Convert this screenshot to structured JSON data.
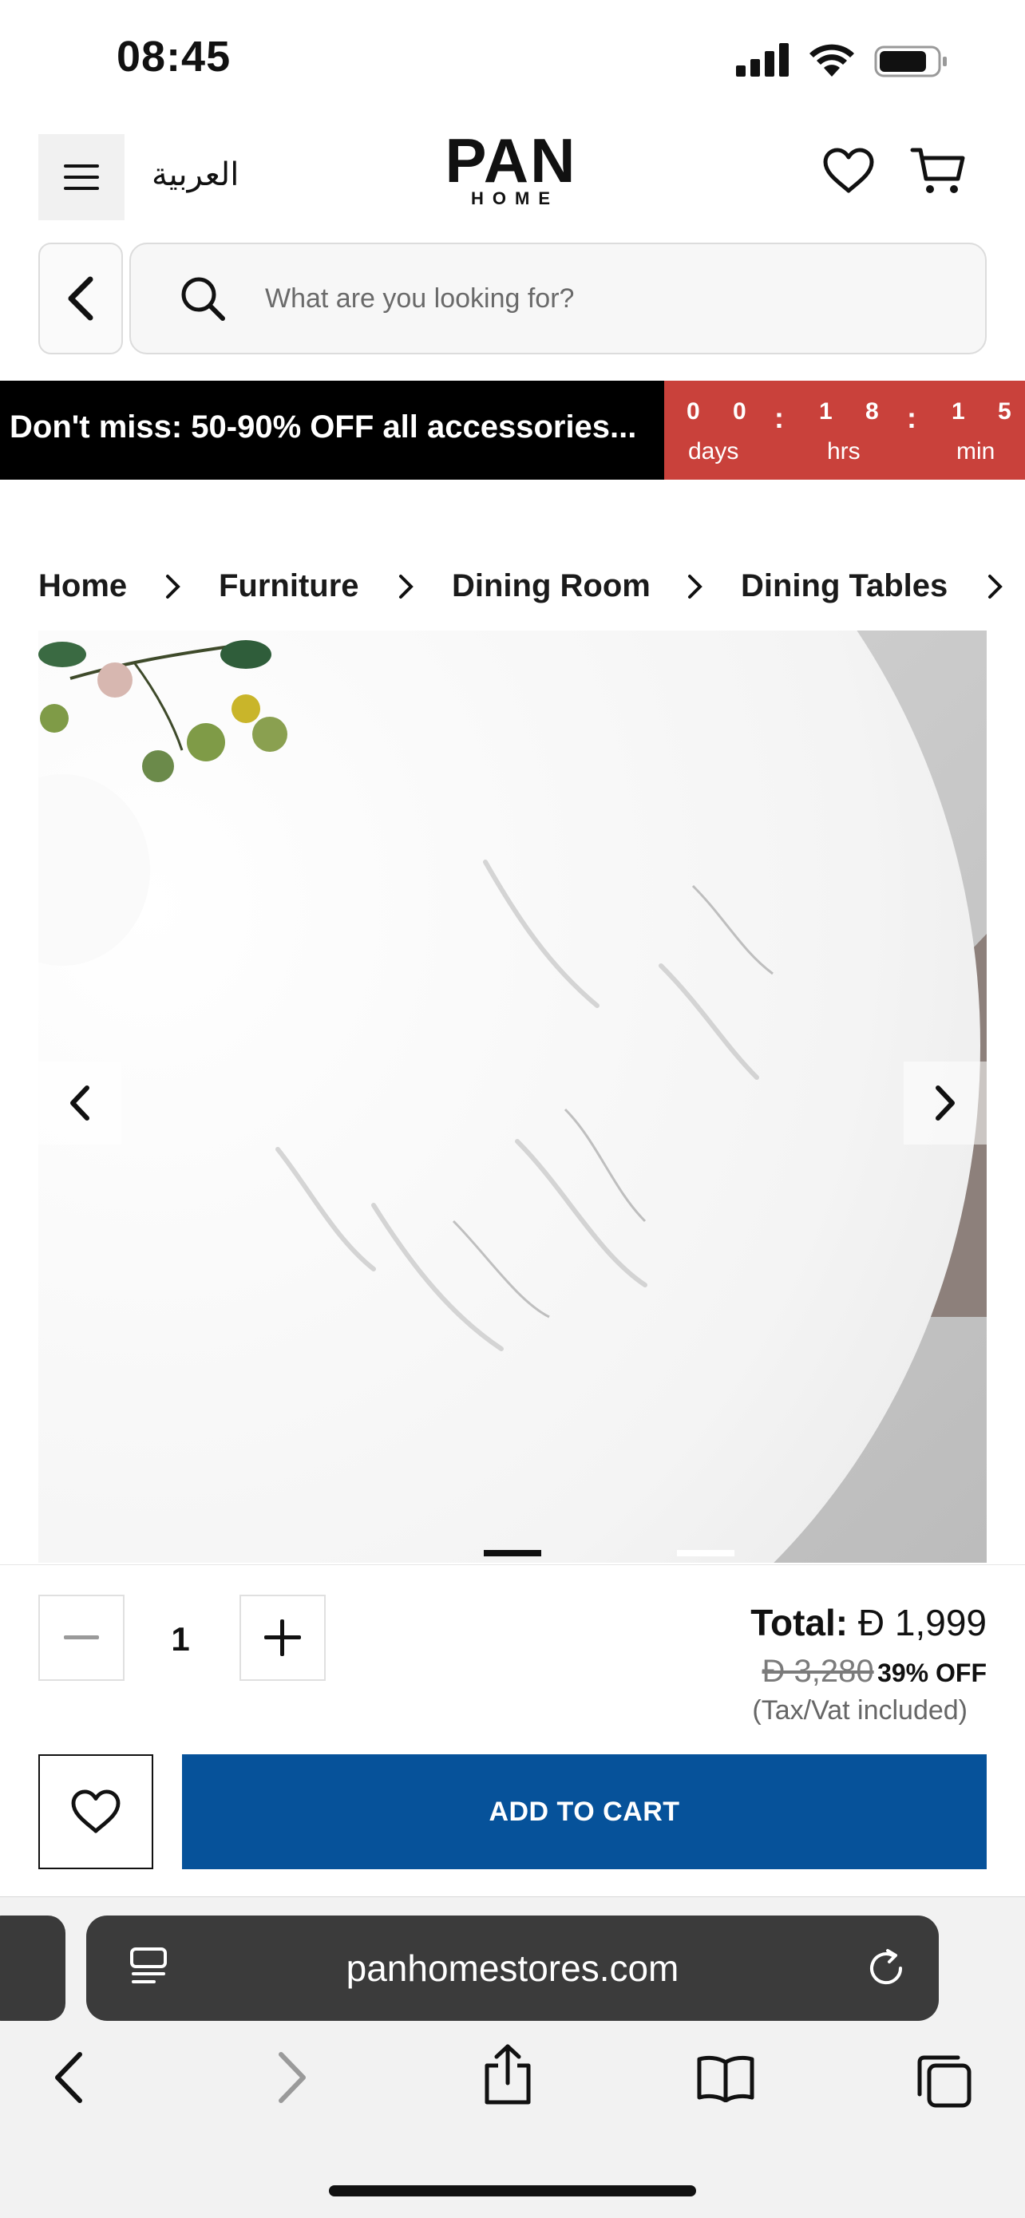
{
  "status_bar": {
    "time": "08:45",
    "icons": [
      "signal-icon",
      "wifi-icon",
      "battery-icon"
    ]
  },
  "header": {
    "language_link": "العربية",
    "logo": {
      "main": "PAN",
      "sub": "HOME"
    }
  },
  "search": {
    "placeholder": "What are you looking for?"
  },
  "promo": {
    "text": "Don't miss: 50-90% OFF all accessories...",
    "countdown": {
      "days": [
        "0",
        "0"
      ],
      "hours": [
        "1",
        "8"
      ],
      "minutes": [
        "1",
        "5"
      ],
      "labels": {
        "days": "days",
        "hours": "hrs",
        "minutes": "min"
      }
    }
  },
  "breadcrumb": [
    "Home",
    "Furniture",
    "Dining Room",
    "Dining Tables"
  ],
  "gallery": {
    "image_count": 2,
    "active_index": 0
  },
  "purchase": {
    "quantity": "1",
    "total_label": "Total:",
    "currency_symbol": "Ð",
    "price": "1,999",
    "old_price": "Ð 3,280",
    "discount": "39% OFF",
    "tax_note": "(Tax/Vat included)",
    "add_to_cart": "ADD TO CART"
  },
  "browser": {
    "url": "panhomestores.com"
  },
  "colors": {
    "accent_blue": "#06529a",
    "countdown_red": "#c9413b",
    "promo_black": "#000000"
  }
}
